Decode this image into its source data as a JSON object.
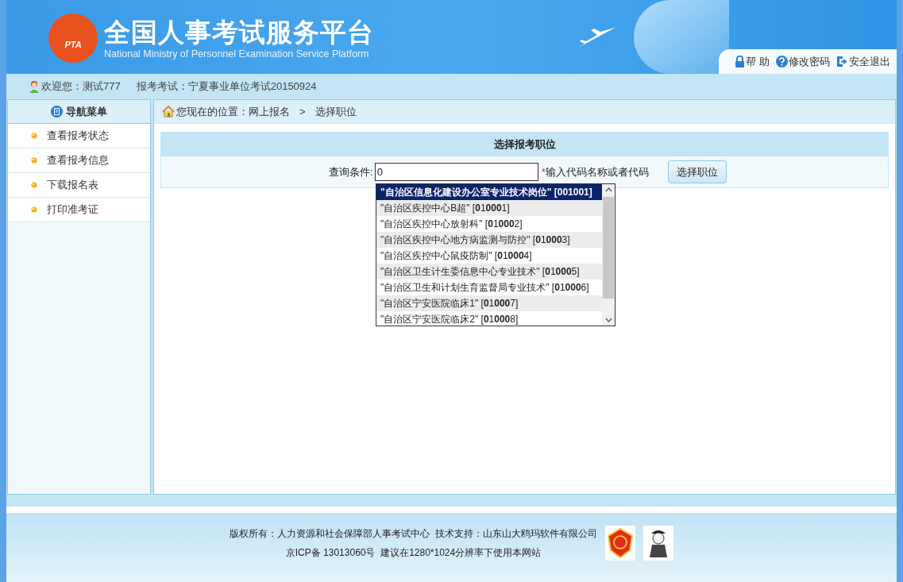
{
  "header": {
    "title": "全国人事考试服务平台",
    "subtitle": "National Ministry of Personnel Examination Service Platform",
    "logo_text": "PTA",
    "links": [
      {
        "kind": "help",
        "label": "帮 助"
      },
      {
        "kind": "password",
        "label": "修改密码"
      },
      {
        "kind": "logout",
        "label": "安全退出"
      }
    ]
  },
  "user_bar": {
    "welcome": "欢迎您：测试777",
    "exam": "报考考试：宁夏事业单位考试20150924"
  },
  "sidebar": {
    "title": "导航菜单",
    "items": [
      {
        "label": "查看报考状态"
      },
      {
        "label": "查看报考信息"
      },
      {
        "label": "下载报名表"
      },
      {
        "label": "打印准考证"
      }
    ]
  },
  "breadcrumb": {
    "prefix": "您现在的位置：网上报名",
    "separator": ">",
    "current": "选择职位"
  },
  "panel": {
    "title": "选择报考职位",
    "query_label": "查询条件:",
    "query_value": "0",
    "required_mark": "*",
    "hint": "输入代码名称或者代码",
    "button": "选择职位"
  },
  "suggestions": [
    {
      "text": "\"自治区信息化建设办公室专业技术岗位\" [001001]",
      "selected": true
    },
    {
      "text": "\"自治区疾控中心B超\" [**0**1**000**1]",
      "selected": false
    },
    {
      "text": "\"自治区疾控中心放射科\" [**0**1**000**2]",
      "selected": false
    },
    {
      "text": "\"自治区疾控中心地方病监测与防控\" [**0**1**000**3]",
      "selected": false
    },
    {
      "text": "\"自治区疾控中心鼠疫防制\" [**0**1**000**4]",
      "selected": false
    },
    {
      "text": "\"自治区卫生计生委信息中心专业技术\" [**0**1**000**5]",
      "selected": false
    },
    {
      "text": "\"自治区卫生和计划生育监督局专业技术\" [**0**1**000**6]",
      "selected": false
    },
    {
      "text": "\"自治区宁安医院临床1\" [**0**1**000**7]",
      "selected": false
    },
    {
      "text": "\"自治区宁安医院临床2\" [**0**1**000**8]",
      "selected": false
    }
  ],
  "footer": {
    "lines": [
      "版权所有：人力资源和社会保障部人事考试中心  技术支持：山东山大鸥玛软件有限公司",
      "京ICP备 13013060号  建议在1280*1024分辨率下使用本网站"
    ]
  }
}
